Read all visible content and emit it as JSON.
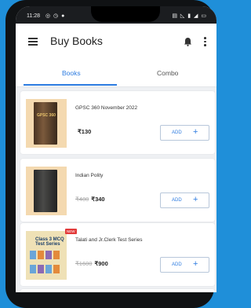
{
  "status_bar": {
    "time": "11:28",
    "left_icons": "◎ ◷ ●",
    "right_icons": "▤ ◺ ▮ ◢ ▭"
  },
  "app_bar": {
    "title": "Buy Books"
  },
  "tabs": [
    {
      "label": "Books",
      "active": true
    },
    {
      "label": "Combo",
      "active": false
    }
  ],
  "products": [
    {
      "title": "GPSC 360 November 2022",
      "price": "₹130",
      "old_price": "",
      "add_label": "ADD",
      "cover_text": "GPSC 360"
    },
    {
      "title": "Indian Polity",
      "price": "₹340",
      "old_price": "₹480",
      "add_label": "ADD",
      "cover_text": ""
    },
    {
      "title": "Talati and Jr.Clerk Test Series",
      "price": "₹900",
      "old_price": "₹1600",
      "add_label": "ADD",
      "badge": "NEW",
      "cover_text": "Class 3 MCQ Test Series"
    }
  ],
  "colors": {
    "accent": "#2c7be0",
    "background_outer": "#1f8fd9",
    "new_badge": "#e23b3b"
  },
  "icons": [
    "hamburger-menu-icon",
    "bell-icon",
    "more-vert-icon",
    "plus-icon"
  ]
}
